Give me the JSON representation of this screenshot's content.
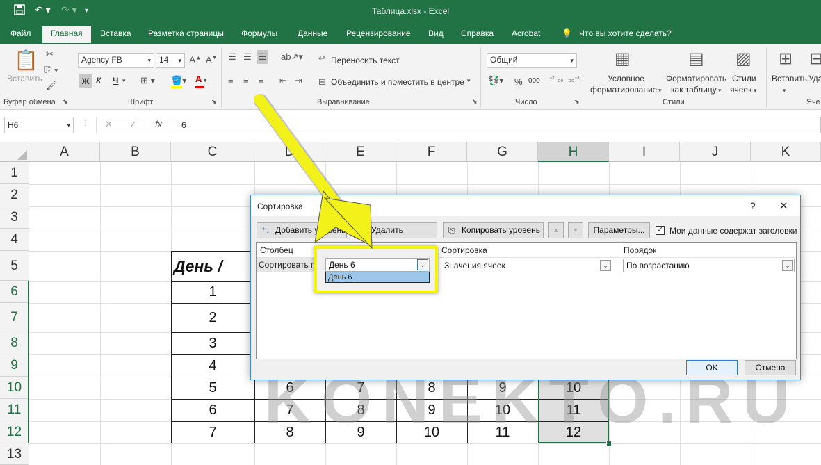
{
  "window": {
    "title": "Таблица.xlsx  -  Excel"
  },
  "tabs": [
    "Файл",
    "Главная",
    "Вставка",
    "Разметка страницы",
    "Формулы",
    "Данные",
    "Рецензирование",
    "Вид",
    "Справка",
    "Acrobat",
    "Что вы хотите сделать?"
  ],
  "ribbon": {
    "paste_label": "Вставить",
    "clipboard_label": "Буфер обмена",
    "font_name": "Agency FB",
    "font_size": "14",
    "bold": "Ж",
    "italic": "К",
    "underline": "Ч",
    "font_group": "Шрифт",
    "wrap_text": "Переносить текст",
    "merge_center": "Объединить и поместить в центре",
    "align_group": "Выравнивание",
    "number_format": "Общий",
    "number_group": "Число",
    "percent": "%",
    "thousands": "000",
    "cond_format_1": "Условное",
    "cond_format_2": "форматирование",
    "format_table_1": "Форматировать",
    "format_table_2": "как таблицу",
    "cell_styles_1": "Стили",
    "cell_styles_2": "ячеек",
    "styles_group": "Стили",
    "insert_label": "Вставить",
    "delete_label": "Уда",
    "cells_group": "Яче"
  },
  "formula_bar": {
    "name_box": "H6",
    "fx": "fx",
    "value": "6"
  },
  "columns": [
    "A",
    "B",
    "C",
    "D",
    "E",
    "F",
    "G",
    "H",
    "I",
    "J",
    "K"
  ],
  "rows": [
    "1",
    "2",
    "3",
    "4",
    "5",
    "6",
    "7",
    "8",
    "9",
    "10",
    "11",
    "12",
    "13"
  ],
  "cells": {
    "c5": "День /",
    "c6": "1",
    "c7": "2",
    "c8": "3",
    "c9": "4",
    "c10": "5",
    "c11": "6",
    "c12": "7",
    "d10": "6",
    "d11": "7",
    "d12": "8",
    "e10": "7",
    "e11": "8",
    "e12": "9",
    "f10": "8",
    "f11": "9",
    "f12": "10",
    "g10": "9",
    "g11": "10",
    "g12": "11",
    "h10": "10",
    "h11": "11",
    "h12": "12"
  },
  "dialog": {
    "title": "Сортировка",
    "help": "?",
    "close": "✕",
    "add_level": "Добавить уровень",
    "delete_level": "Удалить уровень",
    "copy_level": "Копировать уровень",
    "params": "Параметры...",
    "has_headers": "Мои данные содержат заголовки",
    "col_header": "Столбец",
    "sort_header": "Сортировка",
    "order_header": "Порядок",
    "sort_by": "Сортировать по",
    "column_value": "День 6",
    "dropdown_option": "День 6",
    "sort_on": "Значения ячеек",
    "order": "По возрастанию",
    "ok": "OK",
    "cancel": "Отмена"
  },
  "watermark": "KONEKTO.RU",
  "colors": {
    "excel_green": "#217346",
    "highlight_yellow": "#f5f500",
    "arrow_yellow": "#f2f21a"
  }
}
